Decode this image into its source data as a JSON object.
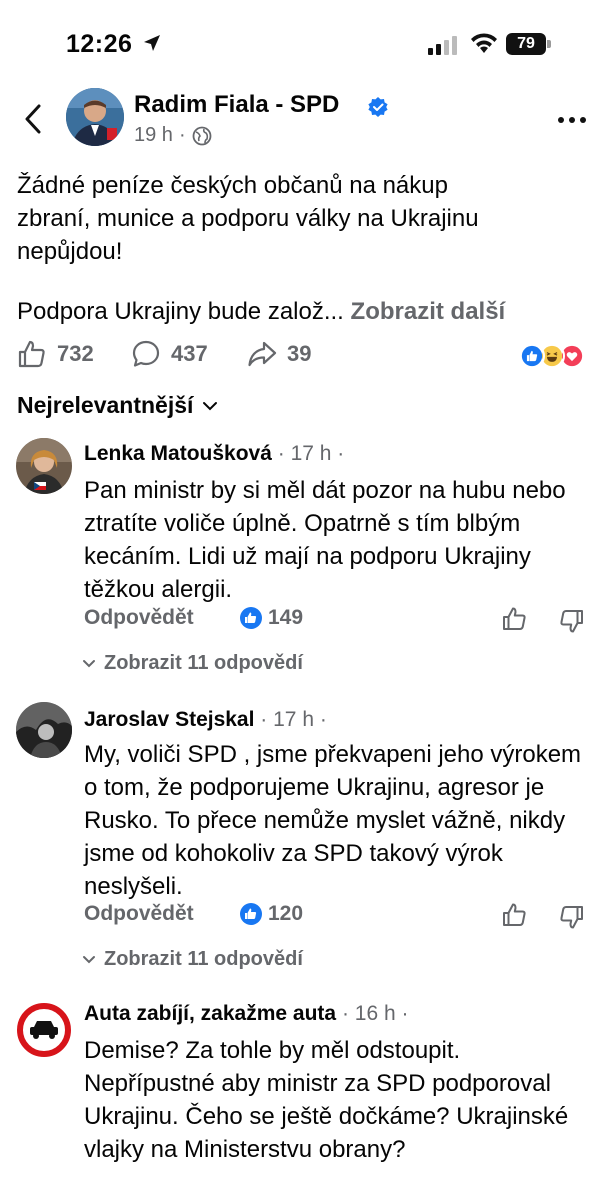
{
  "status_bar": {
    "time": "12:26",
    "battery": "79",
    "icons": [
      "location-arrow-icon",
      "signal-icon",
      "wifi-icon",
      "battery-icon"
    ]
  },
  "header": {
    "page_name": "Radim Fiala - SPD",
    "time_ago": "19 h",
    "separator": "·",
    "icons": [
      "back-icon",
      "verified-icon",
      "globe-icon",
      "more-icon"
    ]
  },
  "post": {
    "text_line1": "Žádné peníze českých občanů na nákup",
    "text_line2": "zbraní, munice a podporu války na Ukrajinu",
    "text_line3": "nepůjdou!",
    "text_para2": "Podpora Ukrajiny bude založ...",
    "see_more": "Zobrazit další"
  },
  "reactions": {
    "likes": "732",
    "comments": "437",
    "shares": "39",
    "emoji_icons": [
      "like-emoji-icon",
      "haha-emoji-icon",
      "love-emoji-icon"
    ]
  },
  "sort": {
    "label": "Nejrelevantnější"
  },
  "comments": [
    {
      "author": "Lenka Matoušková",
      "time": "· 17 h ·",
      "text": "Pan ministr by si měl dát pozor na hubu nebo ztratíte voliče úplně. Opatrně s tím blbým kecáním. Lidi už mají na podporu Ukrajiny těžkou alergii.",
      "reply": "Odpovědět",
      "likes": "149",
      "view_replies": "Zobrazit 11 odpovědí"
    },
    {
      "author": "Jaroslav Stejskal",
      "time": "· 17 h ·",
      "text": "My, voliči SPD , jsme překvapeni jeho výrokem o tom, že podporujeme Ukrajinu, agresor je Rusko. To přece nemůže myslet vážně, nikdy jsme od kohokoliv za SPD takový výrok neslyšeli.",
      "reply": "Odpovědět",
      "likes": "120",
      "view_replies": "Zobrazit 11 odpovědí"
    },
    {
      "author": "Auta zabíjí, zakažme auta",
      "time": "· 16 h ·",
      "text": "Demise? Za tohle by měl odstoupit. Nepřípustné aby ministr za SPD podporoval Ukrajinu. Čeho se ještě dočkáme? Ukrajinské vlajky na Ministerstvu obrany?"
    }
  ],
  "colors": {
    "text": "#050505",
    "secondary": "#65676b",
    "accent": "#1877f2"
  }
}
